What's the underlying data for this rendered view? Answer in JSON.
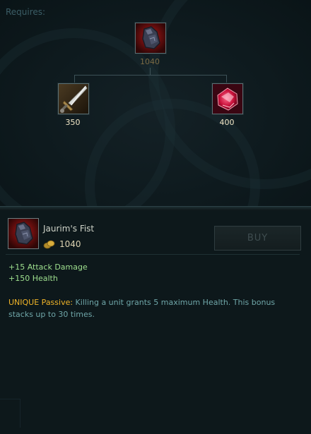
{
  "tree": {
    "requires_label": "Requires:",
    "parent": {
      "name": "Jaurim's Fist",
      "icon": "gauntlet-icon",
      "cost": "1040"
    },
    "children": [
      {
        "name": "Long Sword",
        "icon": "sword-icon",
        "cost": "350"
      },
      {
        "name": "Ruby Crystal",
        "icon": "ruby-crystal-icon",
        "cost": "400"
      }
    ]
  },
  "detail": {
    "name": "Jaurim's Fist",
    "icon": "gauntlet-icon",
    "cost": "1040",
    "buy_label": "BUY",
    "stats": [
      "+15 Attack Damage",
      "+150 Health"
    ],
    "passive_label": "UNIQUE Passive:",
    "passive_text": " Killing a unit grants 5 maximum Health. This bonus stacks up to 30 times."
  },
  "colors": {
    "stat_green": "#9fe08f",
    "passive_gold": "#f0b428",
    "passive_text": "#6fa6a8"
  }
}
